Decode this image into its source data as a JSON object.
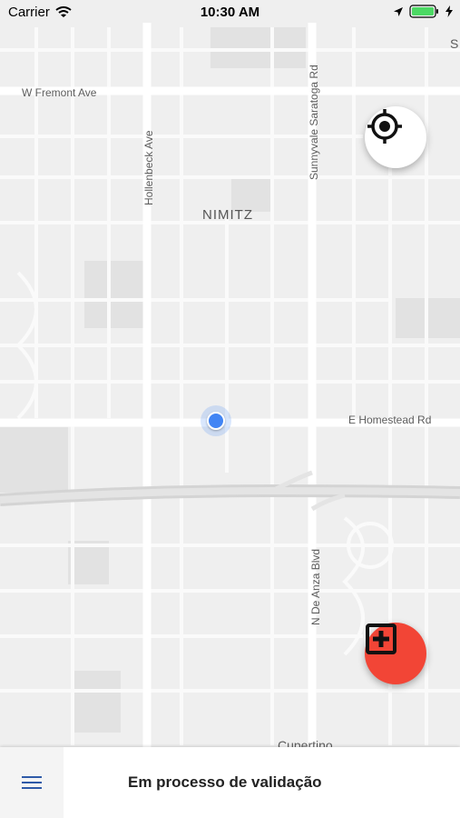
{
  "status_bar": {
    "carrier": "Carrier",
    "time": "10:30 AM"
  },
  "map": {
    "neighborhood": "NIMITZ",
    "streets": {
      "w_fremont": "W Fremont Ave",
      "hollenbeck": "Hollenbeck Ave",
      "sunnyvale_saratoga": "Sunnyvale Saratoga Rd",
      "e_homestead": "E Homestead Rd",
      "n_de_anza": "N De Anza Blvd",
      "edge_letter": "S",
      "bottom_partial": "Cupertino"
    }
  },
  "buttons": {
    "locate_icon": "crosshair-icon",
    "add_icon": "plus-square-icon",
    "add_color": "#f24536"
  },
  "bottom_bar": {
    "menu_icon": "hamburger-icon",
    "title": "Em processo de validação"
  }
}
